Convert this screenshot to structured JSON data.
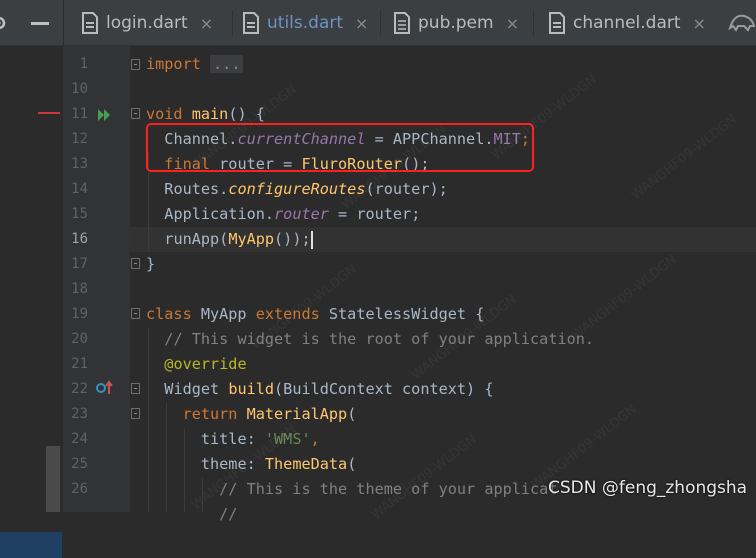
{
  "tabs": [
    {
      "label": "login.dart",
      "icon": "dart-file-icon",
      "active": false
    },
    {
      "label": "utils.dart",
      "icon": "dart-file-icon",
      "active": true
    },
    {
      "label": "pub.pem",
      "icon": "text-file-icon",
      "active": false
    },
    {
      "label": "channel.dart",
      "icon": "dart-file-icon",
      "active": false
    }
  ],
  "tab_close_glyph": "×",
  "line_numbers": [
    "1",
    "10",
    "11",
    "12",
    "13",
    "14",
    "15",
    "16",
    "17",
    "18",
    "19",
    "20",
    "21",
    "22",
    "23",
    "24",
    "25",
    "26"
  ],
  "current_line": "16",
  "code": {
    "l1_import": "import",
    "l1_folded": "...",
    "l11_void": "void",
    "l11_main": "main",
    "l11_rest": "() {",
    "l12_channel": "Channel.",
    "l12_prop": "currentChannel",
    "l12_eq": " = APPChannel.",
    "l12_const": "MIT",
    "l12_semi": ";",
    "l13_final": "final",
    "l13_router": " router = ",
    "l13_ctor": "FluroRouter",
    "l13_end": "();",
    "l14_routes": "Routes.",
    "l14_fn": "configureRoutes",
    "l14_end": "(router);",
    "l15_app": "Application.",
    "l15_prop": "router",
    "l15_end": " = router;",
    "l16_run": "runApp(",
    "l16_fn": "MyApp",
    "l16_end": "());",
    "l17": "}",
    "l19_class": "class",
    "l19_name": " MyApp ",
    "l19_extends": "extends",
    "l19_rest": " StatelessWidget {",
    "l20_comment": "// This widget is the root of your application.",
    "l21_ann": "@override",
    "l22_widget": "Widget ",
    "l22_fn": "build",
    "l22_rest": "(BuildContext context) {",
    "l23_return": "return ",
    "l23_fn": "MaterialApp",
    "l23_rest": "(",
    "l24_title": "title: ",
    "l24_str": "'WMS'",
    "l24_end": ",",
    "l25_theme": "theme: ",
    "l25_fn": "ThemeData",
    "l25_rest": "(",
    "l26_comment": "// This is the theme of your applicat",
    "l27_comment": "//"
  },
  "watermark_text": "CSDN @feng_zhongsha",
  "bg_watermark": "WANGHF09-WLDGN",
  "colors": {
    "highlight_box": "#ff1f1f",
    "keyword": "#cc7832",
    "function": "#ffc66d",
    "property": "#9876aa",
    "string": "#6a8759",
    "comment": "#808080",
    "annotation": "#bbb529"
  }
}
